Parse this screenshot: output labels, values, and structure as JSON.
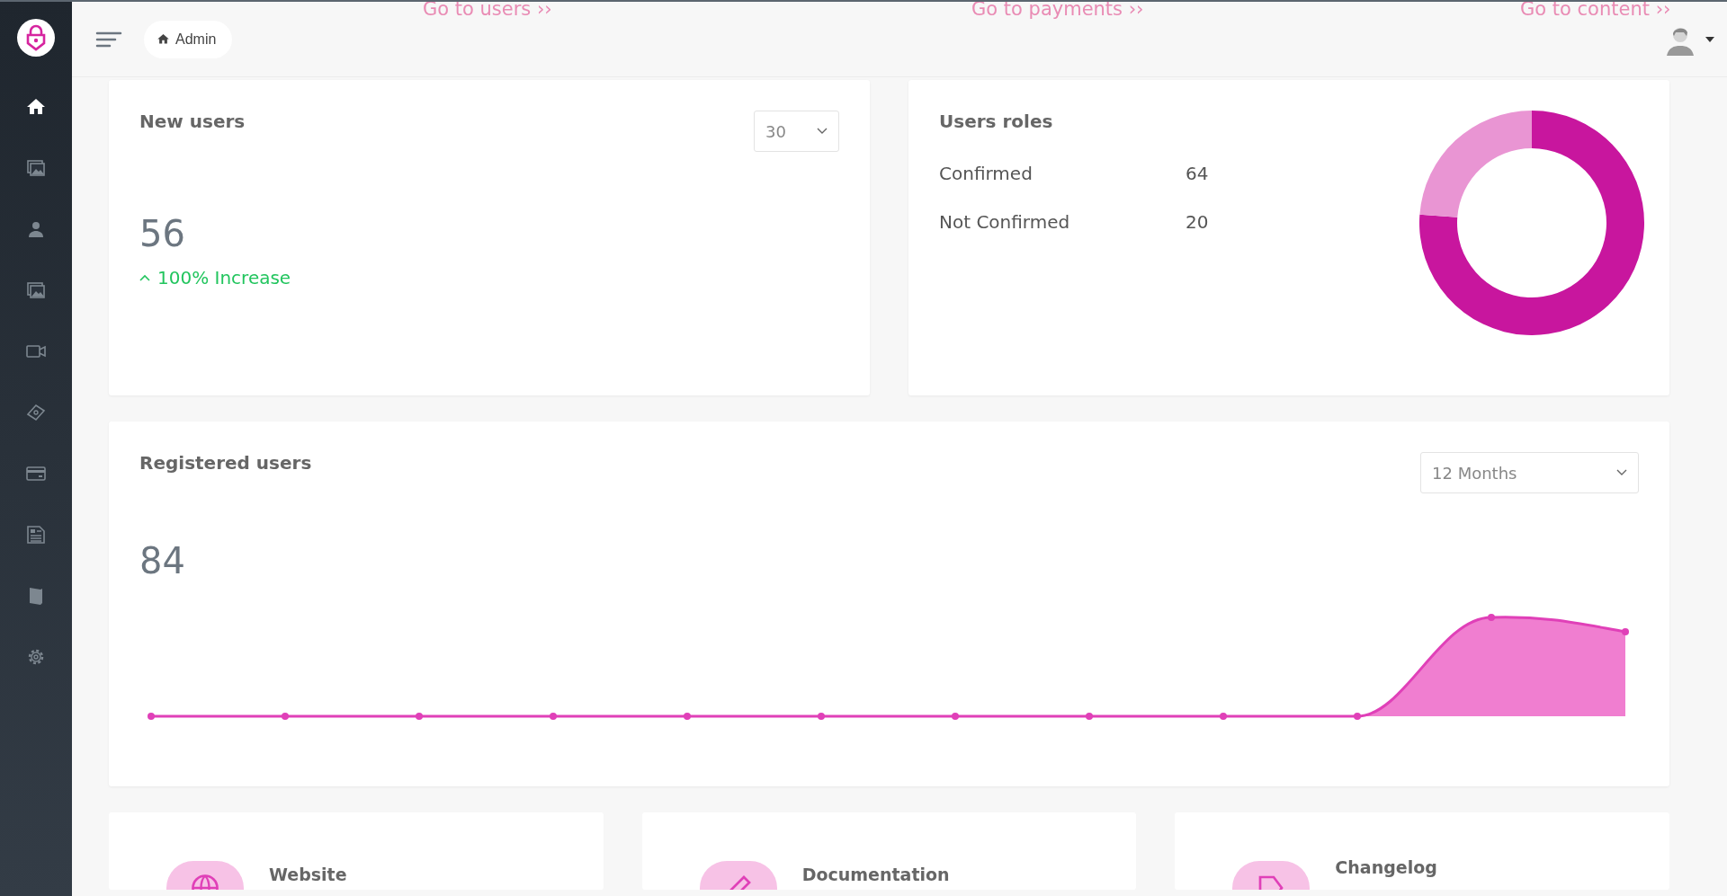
{
  "sidebar": {
    "items": [
      {
        "kind": "home",
        "selected": true
      },
      {
        "kind": "images",
        "selected": false
      },
      {
        "kind": "user",
        "selected": false
      },
      {
        "kind": "images",
        "selected": false
      },
      {
        "kind": "video",
        "selected": false
      },
      {
        "kind": "money",
        "selected": false
      },
      {
        "kind": "card",
        "selected": false
      },
      {
        "kind": "news",
        "selected": false
      },
      {
        "kind": "book",
        "selected": false
      },
      {
        "kind": "gear",
        "selected": false
      }
    ]
  },
  "topbar": {
    "breadcrumb": "Admin",
    "links": [
      "Go to users ››",
      "Go to payments ››",
      "Go to content ››"
    ]
  },
  "new_users": {
    "title": "New users",
    "period": "30",
    "count": "56",
    "change": "100% Increase"
  },
  "users_roles": {
    "title": "Users roles",
    "roles": [
      {
        "label": "Confirmed",
        "count": "64"
      },
      {
        "label": "Not Confirmed",
        "count": "20"
      }
    ]
  },
  "registered_users": {
    "title": "Registered users",
    "period": "12 Months",
    "count": "84"
  },
  "links": [
    {
      "kind": "globe",
      "label": "Website"
    },
    {
      "kind": "pen",
      "label": "Documentation"
    },
    {
      "kind": "tag",
      "label": "Changelog"
    }
  ]
}
